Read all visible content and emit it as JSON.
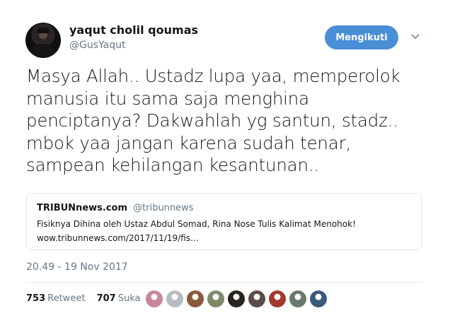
{
  "user": {
    "name": "yaqut cholil qoumas",
    "handle": "@GusYaqut"
  },
  "follow_label": "Mengikuti",
  "tweet_lines": [
    "Masya Allah.. Ustadz lupa yaa, memperolok",
    "manusia itu sama saja menghina",
    "penciptanya? Dakwahlah yg santun, stadz..",
    "mbok yaa jangan karena sudah tenar,",
    "sampean kehilangan kesantunan.."
  ],
  "quoted": {
    "name": "TRIBUNnews.com",
    "handle": "@tribunnews",
    "text": "Fisiknya Dihina oleh Ustaz Abdul Somad, Rina Nose Tulis Kalimat Menohok!",
    "link": "wow.tribunnews.com/2017/11/19/fis…"
  },
  "timestamp": "20.49 - 19 Nov 2017",
  "stats": {
    "retweets": "753",
    "retweets_label": "Retweet",
    "likes": "707",
    "likes_label": "Suka"
  },
  "likers": [
    {
      "color": "#c9869a"
    },
    {
      "color": "#b7bcc2"
    },
    {
      "color": "#8a5a3c"
    },
    {
      "color": "#7d8a6a"
    },
    {
      "color": "#2a2320"
    },
    {
      "color": "#5a4a48"
    },
    {
      "color": "#a23a2e"
    },
    {
      "color": "#6a7a6a"
    },
    {
      "color": "#3a5a7a"
    }
  ],
  "colors": {
    "accent": "#4a8ed6",
    "muted": "#657786"
  }
}
